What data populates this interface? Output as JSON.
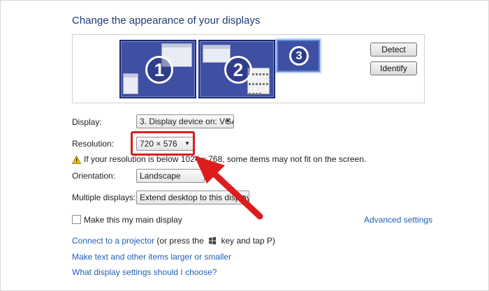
{
  "title": "Change the appearance of your displays",
  "monitors": [
    {
      "number": "1"
    },
    {
      "number": "2"
    },
    {
      "number": "3"
    }
  ],
  "buttons": {
    "detect": "Detect",
    "identify": "Identify"
  },
  "display": {
    "label": "Display:",
    "value": "3. Display device on: VGA"
  },
  "resolution": {
    "label": "Resolution:",
    "value": "720 × 576"
  },
  "warning": "If your resolution is below 1024 x 768, some items may not fit on the screen.",
  "orientation": {
    "label": "Orientation:",
    "value": "Landscape"
  },
  "multiple": {
    "label": "Multiple displays:",
    "value": "Extend desktop to this display"
  },
  "main_display": "Make this my main display",
  "advanced": "Advanced settings",
  "links": {
    "projector_link": "Connect to a projector",
    "projector_rest_a": " (or press the ",
    "projector_rest_b": " key and tap P)",
    "larger": "Make text and other items larger or smaller",
    "help": "What display settings should I choose?"
  },
  "colors": {
    "highlight": "#dd1c1c",
    "link": "#1f5fb5",
    "title": "#1e3a78",
    "monitor": "#3e4fa4"
  }
}
